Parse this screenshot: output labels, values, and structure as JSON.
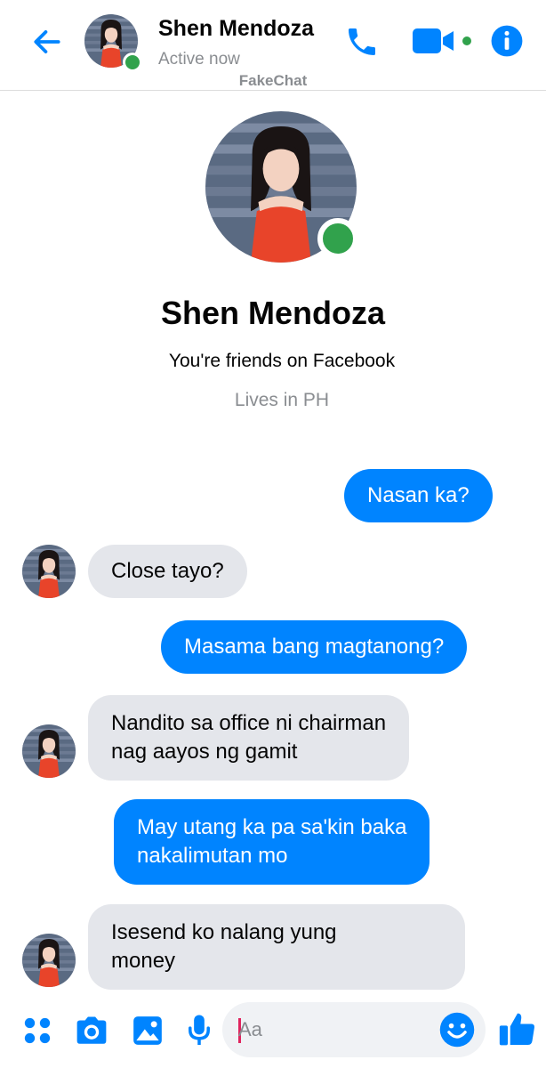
{
  "colors": {
    "accent": "#0084ff",
    "online": "#31a24c",
    "incoming_bubble": "#e4e6eb",
    "muted_text": "#8a8d91"
  },
  "header": {
    "contact_name": "Shen Mendoza",
    "status": "Active now",
    "watermark": "FakeChat",
    "icons": [
      "back-arrow-icon",
      "phone-icon",
      "video-camera-icon",
      "info-icon"
    ]
  },
  "profile": {
    "name": "Shen Mendoza",
    "friends_line": "You're friends on Facebook",
    "lives_line": "Lives in PH"
  },
  "messages": [
    {
      "direction": "out",
      "text": "Nasan ka?"
    },
    {
      "direction": "in",
      "text": "Close tayo?"
    },
    {
      "direction": "out",
      "text": "Masama bang magtanong?"
    },
    {
      "direction": "in",
      "lines": [
        "Nandito sa office ni chairman",
        "nag aayos ng gamit"
      ]
    },
    {
      "direction": "out",
      "lines": [
        "May utang ka pa sa'kin baka",
        "nakalimutan mo"
      ]
    },
    {
      "direction": "in",
      "lines": [
        "Isesend ko nalang yung",
        "money"
      ]
    }
  ],
  "composer": {
    "placeholder": "Aa",
    "icons": [
      "apps-grid-icon",
      "camera-icon",
      "image-icon",
      "microphone-icon",
      "emoji-icon",
      "thumbs-up-icon"
    ]
  }
}
